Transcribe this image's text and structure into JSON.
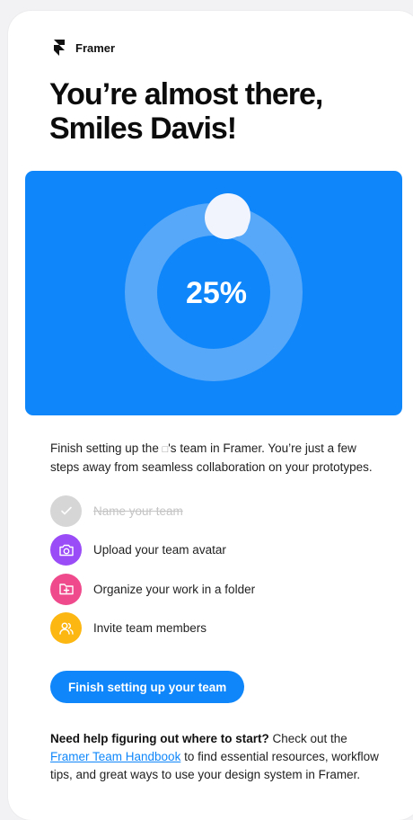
{
  "brand": {
    "name": "Framer",
    "logo_icon": "framer-logo-icon"
  },
  "headline": {
    "line1": "You’re almost there,",
    "line2": "Smiles Davis!"
  },
  "progress": {
    "percent_label": "25%",
    "value": 0.25,
    "colors": {
      "background": "#0f87fa",
      "track": "#58a8f9",
      "fill": "#e6eefb"
    }
  },
  "intro": {
    "text_before": "Finish setting up the ",
    "missing_glyph": "□",
    "text_after": "'s team in Framer. You’re just a few steps away from seamless collaboration on your prototypes."
  },
  "steps": [
    {
      "label": "Name your team",
      "icon": "checkmark-icon",
      "color": "#d6d6d6",
      "done": true
    },
    {
      "label": "Upload your team avatar",
      "icon": "camera-icon",
      "color": "#9a4cf6",
      "done": false
    },
    {
      "label": "Organize your work in a folder",
      "icon": "folder-plus-icon",
      "color": "#ef4b8c",
      "done": false
    },
    {
      "label": "Invite team members",
      "icon": "users-icon",
      "color": "#fdb713",
      "done": false
    }
  ],
  "cta": {
    "label": "Finish setting up your team"
  },
  "help": {
    "bold": "Need help figuring out where to start?",
    "text1": " Check out the ",
    "link": "Framer Team Handbook",
    "text2": " to find essential resources, workflow tips, and great ways to use your design system in Framer."
  }
}
